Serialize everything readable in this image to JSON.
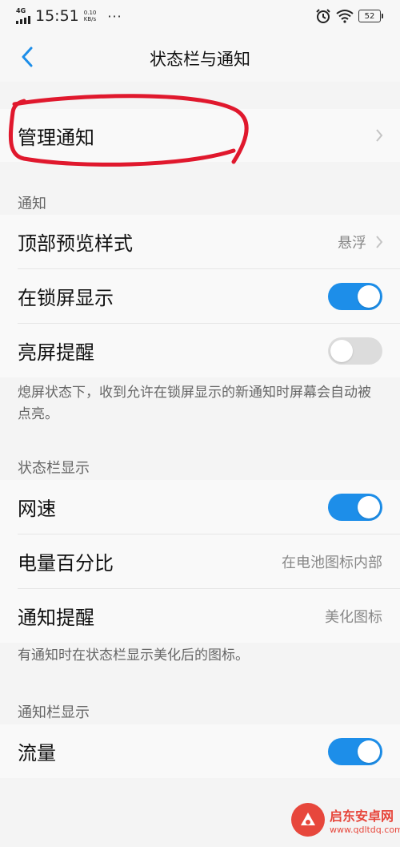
{
  "status_bar": {
    "network": "4G",
    "time": "15:51",
    "speed_value": "0.10",
    "speed_unit": "KB/s",
    "overflow": "···",
    "battery": "52"
  },
  "header": {
    "title": "状态栏与通知"
  },
  "manage": {
    "label": "管理通知"
  },
  "notifications_section": {
    "heading": "通知",
    "preview_style": {
      "label": "顶部预览样式",
      "value": "悬浮"
    },
    "lock_screen": {
      "label": "在锁屏显示",
      "enabled": true
    },
    "wake_screen": {
      "label": "亮屏提醒",
      "enabled": false
    },
    "note": "熄屏状态下，收到允许在锁屏显示的新通知时屏幕会自动被点亮。"
  },
  "statusbar_section": {
    "heading": "状态栏显示",
    "network_speed": {
      "label": "网速",
      "enabled": true
    },
    "battery_percent": {
      "label": "电量百分比",
      "value": "在电池图标内部"
    },
    "notify_icon": {
      "label": "通知提醒",
      "value": "美化图标"
    },
    "note": "有通知时在状态栏显示美化后的图标。"
  },
  "shade_section": {
    "heading": "通知栏显示",
    "data_usage": {
      "label": "流量",
      "enabled": true
    }
  },
  "watermark": {
    "line1": "启东安卓网",
    "line2": "www.qdltdq.com"
  },
  "colors": {
    "accent": "#1d8ee9",
    "annotation": "#e0182d"
  },
  "icons": [
    "back-arrow-icon",
    "chevron-right-icon",
    "alarm-icon",
    "wifi-icon",
    "battery-icon",
    "signal-icon"
  ]
}
